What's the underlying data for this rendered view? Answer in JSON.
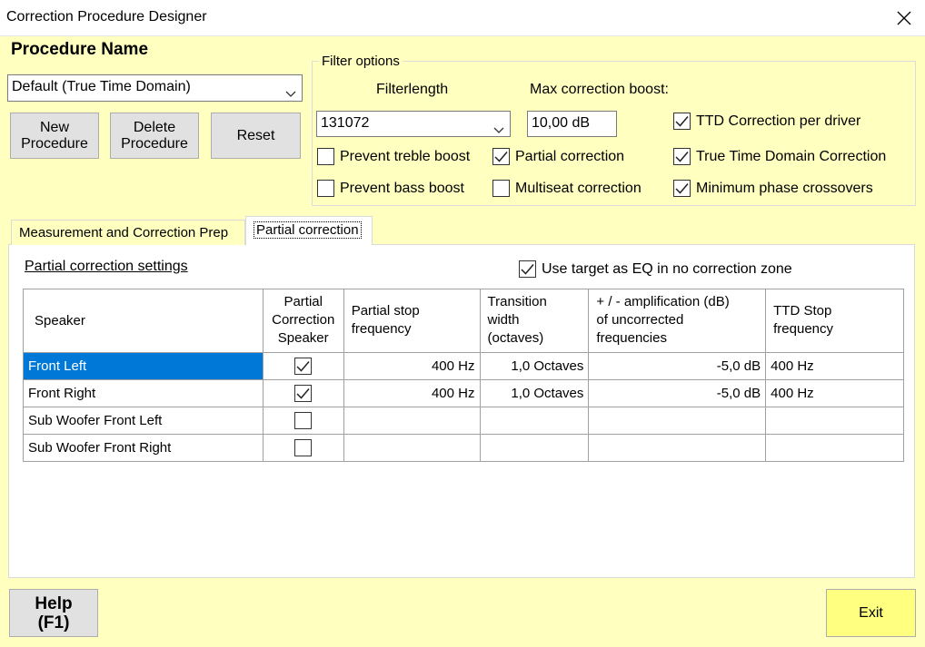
{
  "window": {
    "title": "Correction Procedure Designer"
  },
  "procedure": {
    "heading": "Procedure Name",
    "selected": "Default (True Time Domain)",
    "buttons": {
      "new": "New Procedure",
      "delete": "Delete Procedure",
      "reset": "Reset"
    }
  },
  "filter_options": {
    "title": "Filter options",
    "filterlength_label": "Filterlength",
    "filterlength_value": "131072",
    "max_boost_label": "Max correction boost:",
    "max_boost_value": "10,00 dB",
    "checks": {
      "ttd_per_driver": {
        "label": "TTD Correction per driver",
        "checked": true
      },
      "prevent_treble": {
        "label": "Prevent treble boost",
        "checked": false
      },
      "partial_correction": {
        "label": "Partial correction",
        "checked": true
      },
      "true_time_domain": {
        "label": "True Time Domain Correction",
        "checked": true
      },
      "prevent_bass": {
        "label": "Prevent bass boost",
        "checked": false
      },
      "multiseat": {
        "label": "Multiseat correction",
        "checked": false
      },
      "min_phase": {
        "label": "Minimum phase crossovers",
        "checked": true
      }
    }
  },
  "tabs": [
    {
      "label": "Measurement and Correction Prep",
      "active": false
    },
    {
      "label": "Partial correction",
      "active": true
    }
  ],
  "partial": {
    "settings_title": "Partial correction settings",
    "use_target_label": "Use target as EQ in no correction zone",
    "use_target_checked": true,
    "columns": {
      "speaker": "Speaker",
      "pcs_1": "Partial",
      "pcs_2": "Correction",
      "pcs_3": "Speaker",
      "stop_1": "Partial stop",
      "stop_2": "frequency",
      "trans_1": "Transition",
      "trans_2": "width",
      "trans_3": "(octaves)",
      "amp_1": "+ / - amplification (dB)",
      "amp_2": "of uncorrected",
      "amp_3": "frequencies",
      "ttd_1": "TTD Stop",
      "ttd_2": "frequency"
    },
    "rows": [
      {
        "speaker": "Front Left",
        "checked": true,
        "stop": "400 Hz",
        "width": "1,0 Octaves",
        "amp": "-5,0 dB",
        "ttd": "400 Hz",
        "selected": true
      },
      {
        "speaker": "Front Right",
        "checked": true,
        "stop": "400 Hz",
        "width": "1,0 Octaves",
        "amp": "-5,0 dB",
        "ttd": "400 Hz",
        "selected": false
      },
      {
        "speaker": "Sub Woofer Front Left",
        "checked": false,
        "stop": "",
        "width": "",
        "amp": "",
        "ttd": "",
        "selected": false
      },
      {
        "speaker": "Sub Woofer Front Right",
        "checked": false,
        "stop": "",
        "width": "",
        "amp": "",
        "ttd": "",
        "selected": false
      }
    ]
  },
  "footer": {
    "help_1": "Help",
    "help_2": "(F1)",
    "exit": "Exit"
  }
}
